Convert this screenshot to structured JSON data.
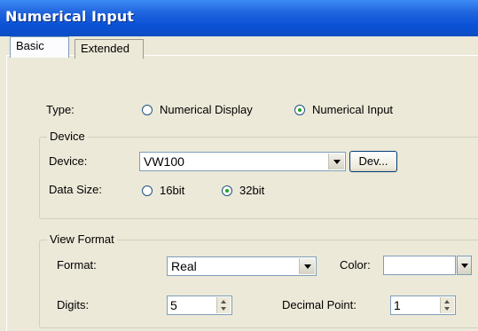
{
  "window": {
    "title": "Numerical Input"
  },
  "tabs": [
    {
      "label": "Basic",
      "active": true
    },
    {
      "label": "Extended",
      "active": false
    }
  ],
  "type": {
    "label": "Type:",
    "options": [
      {
        "label": "Numerical Display",
        "selected": false
      },
      {
        "label": "Numerical Input",
        "selected": true
      }
    ]
  },
  "device_group": {
    "legend": "Device",
    "device_label": "Device:",
    "device_value": "VW100",
    "dev_button": "Dev...",
    "data_size_label": "Data Size:",
    "data_size_options": [
      {
        "label": "16bit",
        "selected": false
      },
      {
        "label": "32bit",
        "selected": true
      }
    ]
  },
  "view_format": {
    "legend": "View Format",
    "format_label": "Format:",
    "format_value": "Real",
    "color_label": "Color:",
    "color_value": "#ffffff",
    "digits_label": "Digits:",
    "digits_value": "5",
    "decimal_point_label": "Decimal Point:",
    "decimal_point_value": "1"
  }
}
